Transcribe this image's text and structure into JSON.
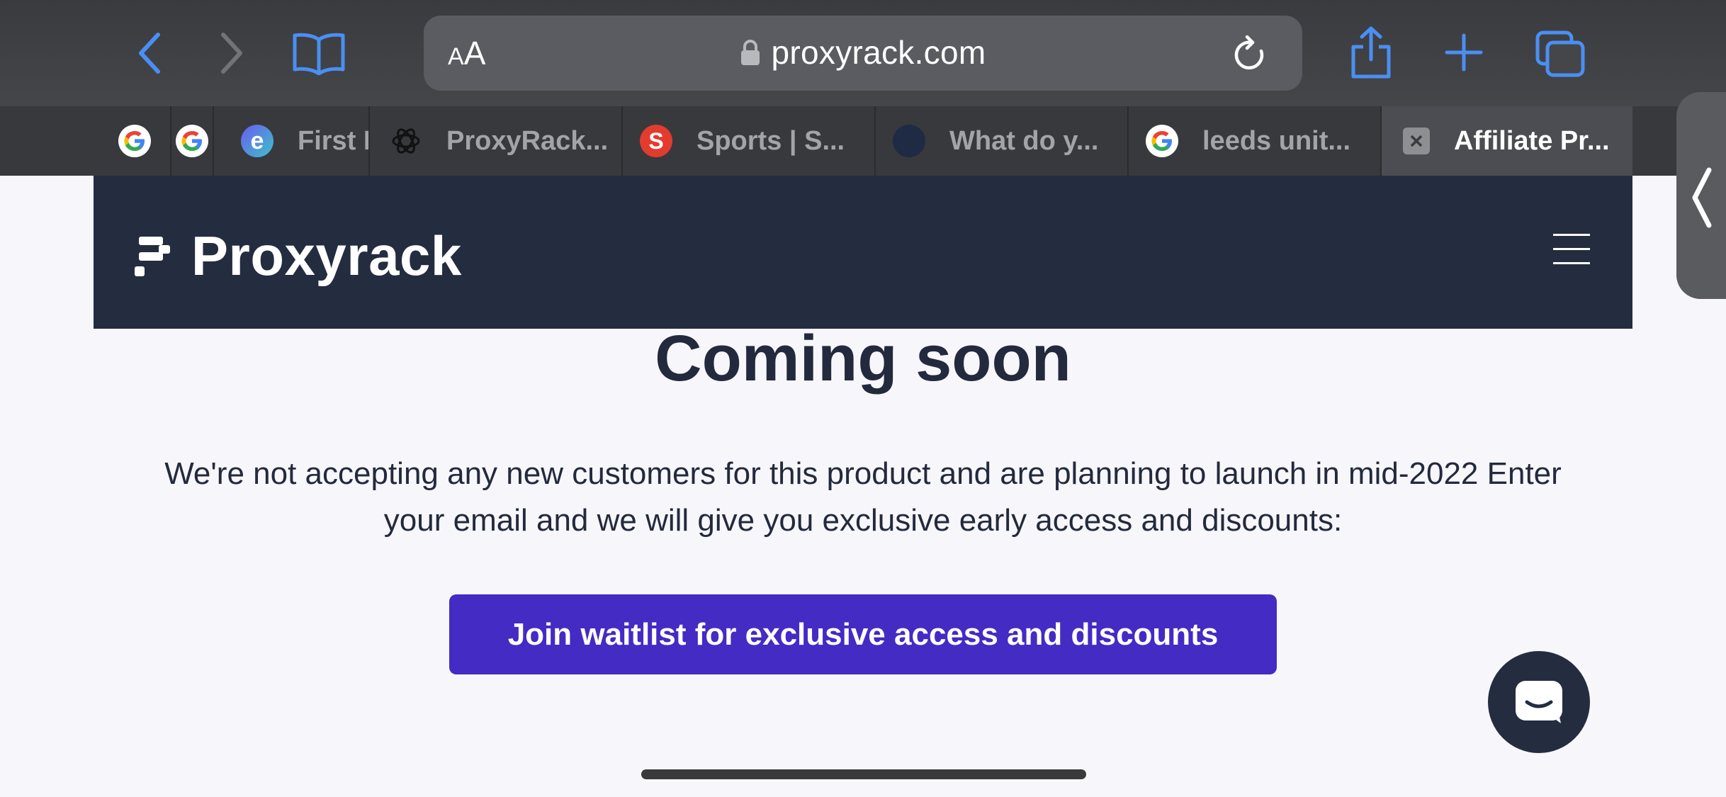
{
  "browser": {
    "aa_small": "A",
    "aa_big": "A",
    "url": "proxyrack.com",
    "tabs": [
      {
        "title": "",
        "icon": "google-icon"
      },
      {
        "title": "",
        "icon": "google-icon"
      },
      {
        "title": "First R",
        "icon": "e-logo-icon"
      },
      {
        "title": "ProxyRack...",
        "icon": "openai-icon"
      },
      {
        "title": "Sports | S...",
        "icon": "sports-logo-icon"
      },
      {
        "title": "What do y...",
        "icon": "globe-icon"
      },
      {
        "title": "leeds unit...",
        "icon": "google-icon"
      },
      {
        "title": "Affiliate Pr...",
        "icon": "close-tab-icon"
      }
    ]
  },
  "site": {
    "brand": "Proxyrack",
    "title": "Coming soon",
    "description": "We're not accepting any new customers for this product and are planning to launch in mid-2022 Enter your email and we will give you exclusive early access and discounts:",
    "cta_label": "Join waitlist for exclusive access and discounts"
  },
  "colors": {
    "header_bg": "#242c40",
    "cta_bg": "#432bc4",
    "accent_blue": "#3b82f6",
    "text": "#232a3d"
  }
}
